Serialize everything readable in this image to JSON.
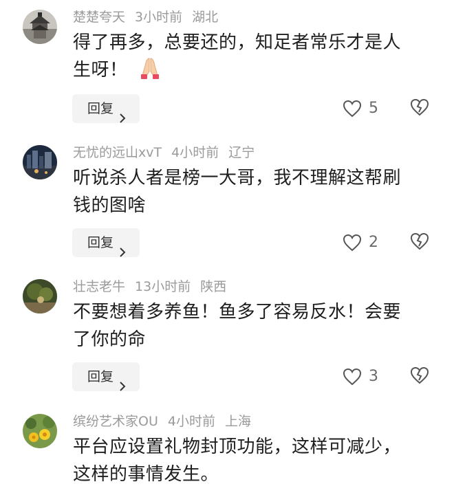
{
  "comments": [
    {
      "username": "楚楚夸天",
      "time": "3小时前",
      "location": "湖北",
      "line1": "得了再多，总要还的，知足者常乐才是人",
      "line2": "生呀！",
      "emoji": "folded-hands-icon",
      "reply_label": "回复",
      "likes": "5"
    },
    {
      "username": "无忧的远山xvT",
      "time": "4小时前",
      "location": "辽宁",
      "line1": "听说杀人者是榜一大哥，我不理解这帮刷",
      "line2": "钱的图啥",
      "reply_label": "回复",
      "likes": "2"
    },
    {
      "username": "壮志老牛",
      "time": "13小时前",
      "location": "陕西",
      "line1": "不要想着多养鱼！鱼多了容易反水！会要",
      "line2": "了你的命",
      "reply_label": "回复",
      "likes": "3"
    },
    {
      "username": "缤纷艺术家OU",
      "time": "4小时前",
      "location": "上海",
      "line1": "平台应设置礼物封顶功能，这样可减少，",
      "line2": "这样的事情发生。"
    }
  ],
  "colors": {
    "meta_text": "#9a9a9a",
    "body_text": "#1e1e1e",
    "reply_bg": "#f3f3f3",
    "icon_stroke": "#555555"
  }
}
